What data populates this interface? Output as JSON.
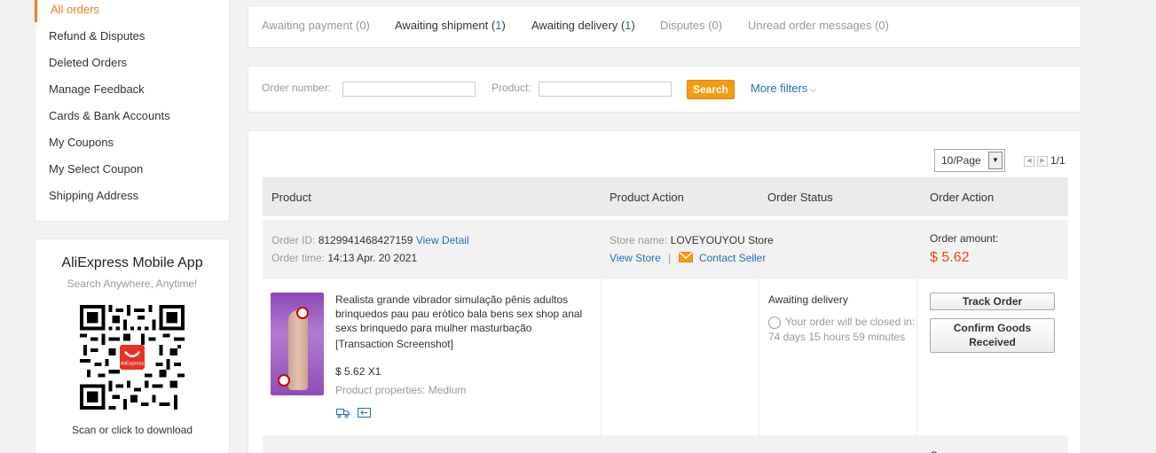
{
  "sidebar": {
    "items": [
      {
        "label": "All orders"
      },
      {
        "label": "Refund & Disputes"
      },
      {
        "label": "Deleted Orders"
      },
      {
        "label": "Manage Feedback"
      },
      {
        "label": "Cards & Bank Accounts"
      },
      {
        "label": "My Coupons"
      },
      {
        "label": "My Select Coupon"
      },
      {
        "label": "Shipping Address"
      }
    ],
    "accent_color": "#f37b1d"
  },
  "app_promo": {
    "title": "AliExpress Mobile App",
    "subtitle": "Search Anywhere, Anytime!",
    "qr_logo": "AliExpress",
    "download": "Scan or click to download"
  },
  "tabs": [
    {
      "label": "Awaiting payment",
      "count": "(0)"
    },
    {
      "label": "Awaiting shipment",
      "count_pre": "(",
      "count_num": "1",
      "count_post": ")"
    },
    {
      "label": "Awaiting delivery",
      "count_pre": "(",
      "count_num": "1",
      "count_post": ")"
    },
    {
      "label": "Disputes",
      "count": "(0)"
    },
    {
      "label": "Unread order messages",
      "count": "(0)"
    }
  ],
  "filters": {
    "order_number_label": "Order number:",
    "product_label": "Product:",
    "search_label": "Search",
    "more_filters_label": "More filters"
  },
  "pagination": {
    "page_size": "10/Page",
    "page": "1/1"
  },
  "table": {
    "headers": [
      "Product",
      "Product Action",
      "Order Status",
      "Order Action"
    ]
  },
  "order": {
    "order_id_label": "Order ID:",
    "order_id": "8129941468427159",
    "view_detail": "View Detail",
    "order_time_label": "Order time:",
    "order_time": "14:13 Apr. 20 2021",
    "store_name_label": "Store name:",
    "store_name": "LOVEYOUYOU Store",
    "view_store": "View Store",
    "separator": "|",
    "contact_seller": "Contact Seller",
    "amount_label": "Order amount:",
    "amount": "$ 5.62",
    "product": {
      "title": "Realista grande vibrador simulação pênis adultos brinquedos pau pau erótico bala bens sex shop anal sexs brinquedo para mulher masturbação",
      "snapshot": "[Transaction Screenshot]",
      "price_qty": "$ 5.62 X1",
      "properties": "Product properties: Medium"
    },
    "status": "Awaiting delivery",
    "remaining": "Your order will be closed in: 74 days 15 hours 59 minutes",
    "track_order": "Track Order",
    "confirm_goods": "Confirm Goods Received"
  },
  "next_order": {
    "label_partial": "Or"
  }
}
